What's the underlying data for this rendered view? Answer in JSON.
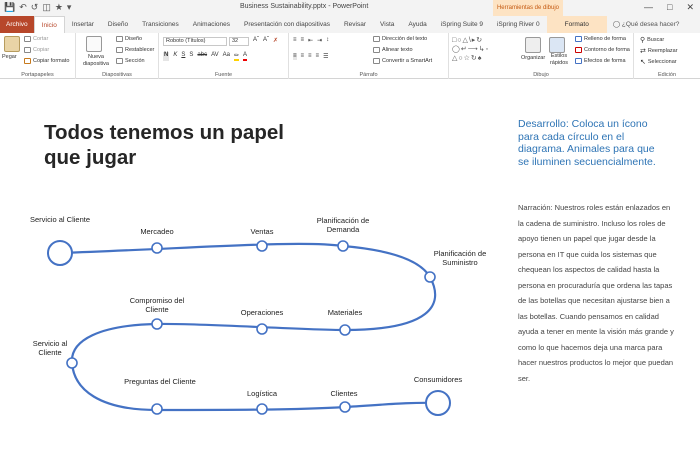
{
  "window": {
    "title": "Business Sustainability.pptx  -  PowerPoint",
    "context_title": "Herramientas de dibujo"
  },
  "tabs": [
    "Archivo",
    "Inicio",
    "Insertar",
    "Diseño",
    "Transiciones",
    "Animaciones",
    "Presentación con diapositivas",
    "Revisar",
    "Vista",
    "Ayuda",
    "iSpring Suite 9",
    "iSpring River 0",
    "Formato"
  ],
  "tell_me": "¿Qué desea hacer?",
  "ribbon": {
    "clipboard": {
      "paste": "Pegar",
      "cut": "Cortar",
      "copy": "Copiar",
      "format_painter": "Copiar formato",
      "label": "Portapapeles"
    },
    "slides": {
      "new_slide": "Nueva diapositiva",
      "layout": "Diseño",
      "reset": "Restablecer",
      "section": "Sección",
      "label": "Diapositivas"
    },
    "font": {
      "font_name": "Roboto (Títulos)",
      "font_size": "32",
      "label": "Fuente"
    },
    "paragraph": {
      "text_direction": "Dirección del texto",
      "align_text": "Alinear texto",
      "smartart": "Convertir a SmartArt",
      "label": "Párrafo"
    },
    "drawing": {
      "arrange": "Organizar",
      "quick_styles": "Estilos rápidos",
      "fill": "Relleno de forma",
      "outline": "Contorno de forma",
      "effects": "Efectos de forma",
      "label": "Dibujo"
    },
    "editing": {
      "find": "Buscar",
      "replace": "Reemplazar",
      "select": "Seleccionar",
      "label": "Edición"
    }
  },
  "slide": {
    "title_line1": "Todos tenemos un papel",
    "title_line2": "que jugar",
    "dev_note": "Desarrollo: Coloca un ícono para cada círculo en el diagrama. Animales para que se iluminen secuencialmente.",
    "narration": "Narración: Nuestros roles están enlazados en la cadena de suministro. Incluso los roles de apoyo tienen un papel que jugar desde la persona en IT que cuida los sistemas que chequean los aspectos de calidad hasta la persona en procuraduría que ordena las tapas de las botellas que necesitan ajustarse bien a las botellas. Cuando pensamos en calidad ayuda a tener en mente la visión más grande y como lo que hacemos deja una marca para hacer nuestros productos lo mejor que puedan ser.",
    "nodes": [
      {
        "label": "Servicio al Cliente"
      },
      {
        "label": "Mercadeo"
      },
      {
        "label": "Ventas"
      },
      {
        "label": "Planificación de Demanda"
      },
      {
        "label": "Planificación de Suministro"
      },
      {
        "label": "Compromiso del Cliente"
      },
      {
        "label": "Operaciones"
      },
      {
        "label": "Materiales"
      },
      {
        "label": "Servicio al Cliente"
      },
      {
        "label": "Preguntas del Cliente"
      },
      {
        "label": "Logística"
      },
      {
        "label": "Clientes"
      },
      {
        "label": "Consumidores"
      }
    ]
  },
  "colors": {
    "accent": "#b7472a",
    "path": "#4472c4",
    "dev_text": "#2e74b5"
  }
}
